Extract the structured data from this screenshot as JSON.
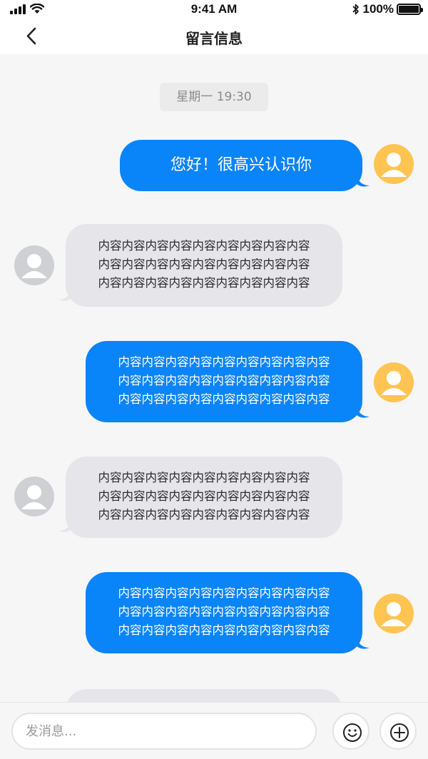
{
  "status_bar": {
    "time": "9:41 AM",
    "battery_percent": "100%",
    "battery_level": 1.0,
    "icons": [
      "signal-icon",
      "wifi-icon",
      "bluetooth-icon",
      "battery-icon"
    ]
  },
  "nav": {
    "title": "留言信息",
    "back_icon": "chevron-left-icon"
  },
  "chat": {
    "timestamp": "星期一  19:30",
    "messages": [
      {
        "sender": "self",
        "lines": [
          "您好！很高兴认识你"
        ]
      },
      {
        "sender": "other",
        "lines": [
          "内容内容内容内容内容内容内容内容内容",
          "内容内容内容内容内容内容内容内容内容",
          "内容内容内容内容内容内容内容内容内容"
        ]
      },
      {
        "sender": "self",
        "lines": [
          "内容内容内容内容内容内容内容内容内容",
          "内容内容内容内容内容内容内容内容内容",
          "内容内容内容内容内容内容内容内容内容"
        ]
      },
      {
        "sender": "other",
        "lines": [
          "内容内容内容内容内容内容内容内容内容",
          "内容内容内容内容内容内容内容内容内容",
          "内容内容内容内容内容内容内容内容内容"
        ]
      },
      {
        "sender": "self",
        "lines": [
          "内容内容内容内容内容内容内容内容内容",
          "内容内容内容内容内容内容内容内容内容",
          "内容内容内容内容内容内容内容内容内容"
        ]
      },
      {
        "sender": "other",
        "lines": []
      }
    ]
  },
  "input_bar": {
    "placeholder": "发消息...",
    "value": "",
    "emoji_icon": "smiley-icon",
    "add_icon": "plus-circle-icon"
  },
  "colors": {
    "self_bubble": "#0a84f9",
    "other_bubble": "#e5e5ea",
    "self_avatar": "#ffc452",
    "other_avatar": "#cfd0d4",
    "background": "#f6f6f6"
  }
}
